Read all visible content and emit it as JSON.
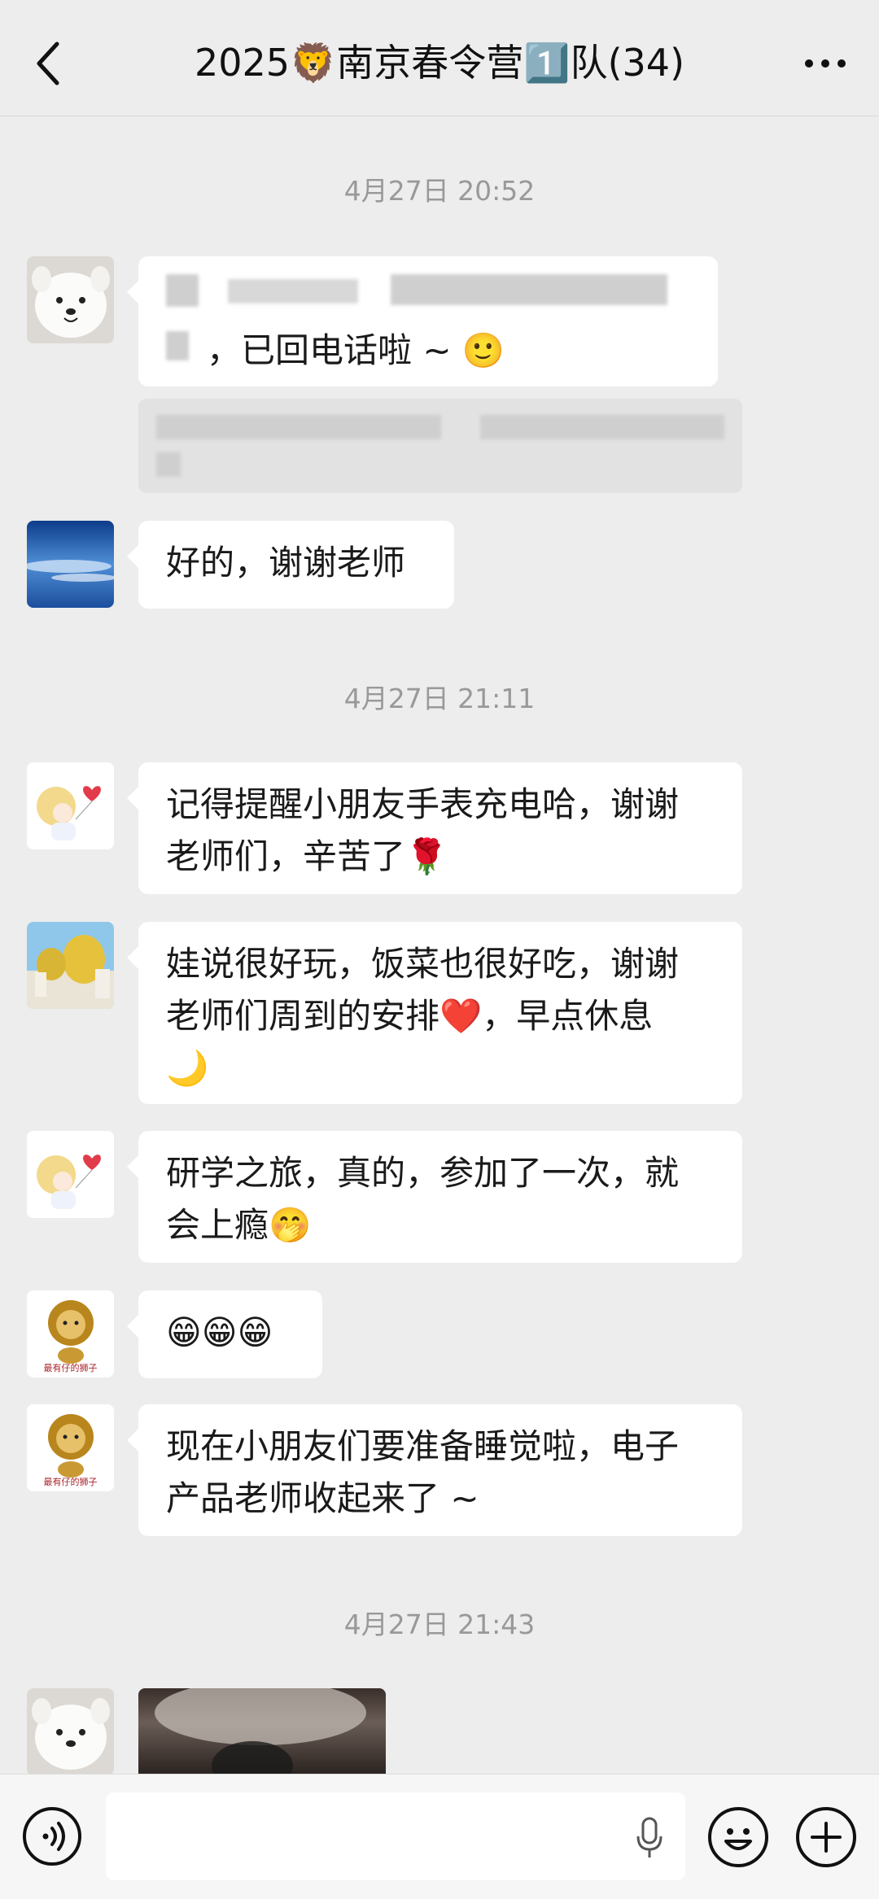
{
  "header": {
    "title": "2025🦁南京春令营1️⃣队(34)",
    "back_icon": "chevron-left-icon",
    "more_icon": "more-dots-icon"
  },
  "timestamps": [
    "4月27日 20:52",
    "4月27日 21:11",
    "4月27日 21:43"
  ],
  "messages": [
    {
      "text_line2": "，已回电话啦 ~ 🙂"
    },
    {
      "text": "好的，谢谢老师"
    },
    {
      "line1": "记得提醒小朋友手表充电哈，谢谢",
      "line2": "老师们，辛苦了🌹"
    },
    {
      "line1": "娃说很好玩，饭菜也很好吃，谢谢",
      "line2": "老师们周到的安排❤️，早点休息",
      "line3": "🌙"
    },
    {
      "line1": "研学之旅，真的，参加了一次，就",
      "line2": "会上瘾🤭"
    },
    {
      "text": "😁😁😁"
    },
    {
      "line1": "现在小朋友们要准备睡觉啦，电子",
      "line2": "产品老师收起来了 ~"
    }
  ],
  "avatars": {
    "dog": "white-dog-avatar",
    "sky": "blue-sky-avatar",
    "child": "child-balloon-avatar",
    "street": "street-scene-avatar",
    "lion": "lion-avatar",
    "lion_caption": "最有仔的狮子"
  },
  "bottom_bar": {
    "voice_icon": "voice-icon",
    "mic_icon": "microphone-icon",
    "emoji_icon": "emoji-icon",
    "plus_icon": "plus-icon"
  }
}
